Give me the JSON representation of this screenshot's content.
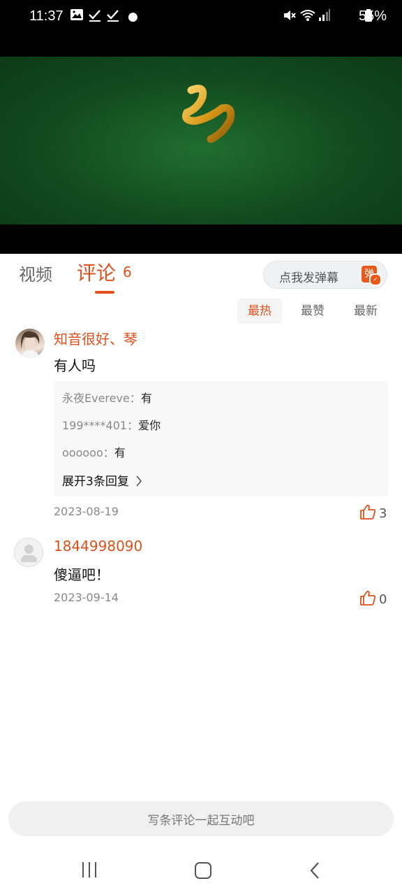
{
  "status_bar": {
    "time": "11:37",
    "battery": "55%",
    "left_icons": [
      "gallery-icon",
      "check-icon",
      "check-icon",
      "dot-icon"
    ],
    "right_icons": [
      "mute-icon",
      "wifi-icon",
      "signal-icon",
      "battery-icon"
    ]
  },
  "video": {
    "description_icon": "gold-ribbon"
  },
  "tabs": {
    "video_label": "视频",
    "comment_label": "评论",
    "comment_count": "6",
    "active_color": "#e0501c"
  },
  "danmu": {
    "label": "点我发弹幕",
    "icon_text": "弹"
  },
  "sort": {
    "hot": "最热",
    "likes": "最赞",
    "newest": "最新",
    "active": "hot"
  },
  "comments": [
    {
      "username": "知音很好、琴",
      "text": "有人吗",
      "replies": [
        {
          "user": "永夜Evereve：",
          "text": "有"
        },
        {
          "user": "199****401：",
          "text": "爱你"
        },
        {
          "user": "oooooo：",
          "text": "有"
        }
      ],
      "expand_label": "展开3条回复",
      "date": "2023-08-19",
      "likes": "3"
    },
    {
      "username": "1844998090",
      "text": "傻逼吧！",
      "date": "2023-09-14",
      "likes": "0"
    }
  ],
  "input": {
    "placeholder": "写条评论一起互动吧"
  },
  "nav": {
    "icons": [
      "recent-apps-icon",
      "home-icon",
      "back-icon"
    ]
  }
}
